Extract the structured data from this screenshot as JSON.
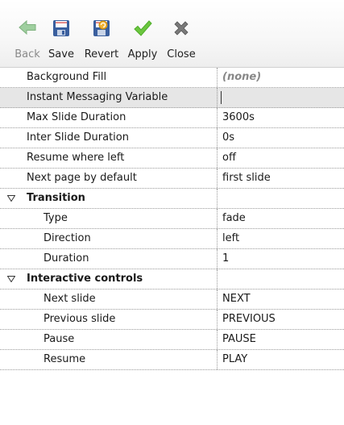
{
  "toolbar": {
    "back_label": "Back",
    "save_label": "Save",
    "revert_label": "Revert",
    "apply_label": "Apply",
    "close_label": "Close",
    "colors": {
      "back_arrow": "#7fb27f",
      "save_disk": "#3a5f9e",
      "apply_check": "#4fae2a",
      "close_x": "#6b6b6b"
    }
  },
  "properties": [
    {
      "name": "Background Fill",
      "value": "(none)"
    },
    {
      "name": "Instant Messaging Variable",
      "value": ""
    },
    {
      "name": "Max Slide Duration",
      "value": "3600s"
    },
    {
      "name": "Inter Slide Duration",
      "value": "0s"
    },
    {
      "name": "Resume where left",
      "value": "off"
    },
    {
      "name": "Next page by default",
      "value": "first slide"
    }
  ],
  "groups": {
    "transition": {
      "label": "Transition",
      "rows": [
        {
          "name": "Type",
          "value": "fade"
        },
        {
          "name": "Direction",
          "value": "left"
        },
        {
          "name": "Duration",
          "value": "1"
        }
      ]
    },
    "interactive": {
      "label": "Interactive controls",
      "rows": [
        {
          "name": "Next slide",
          "value": "NEXT"
        },
        {
          "name": "Previous slide",
          "value": "PREVIOUS"
        },
        {
          "name": "Pause",
          "value": "PAUSE"
        },
        {
          "name": "Resume",
          "value": "PLAY"
        }
      ]
    }
  }
}
